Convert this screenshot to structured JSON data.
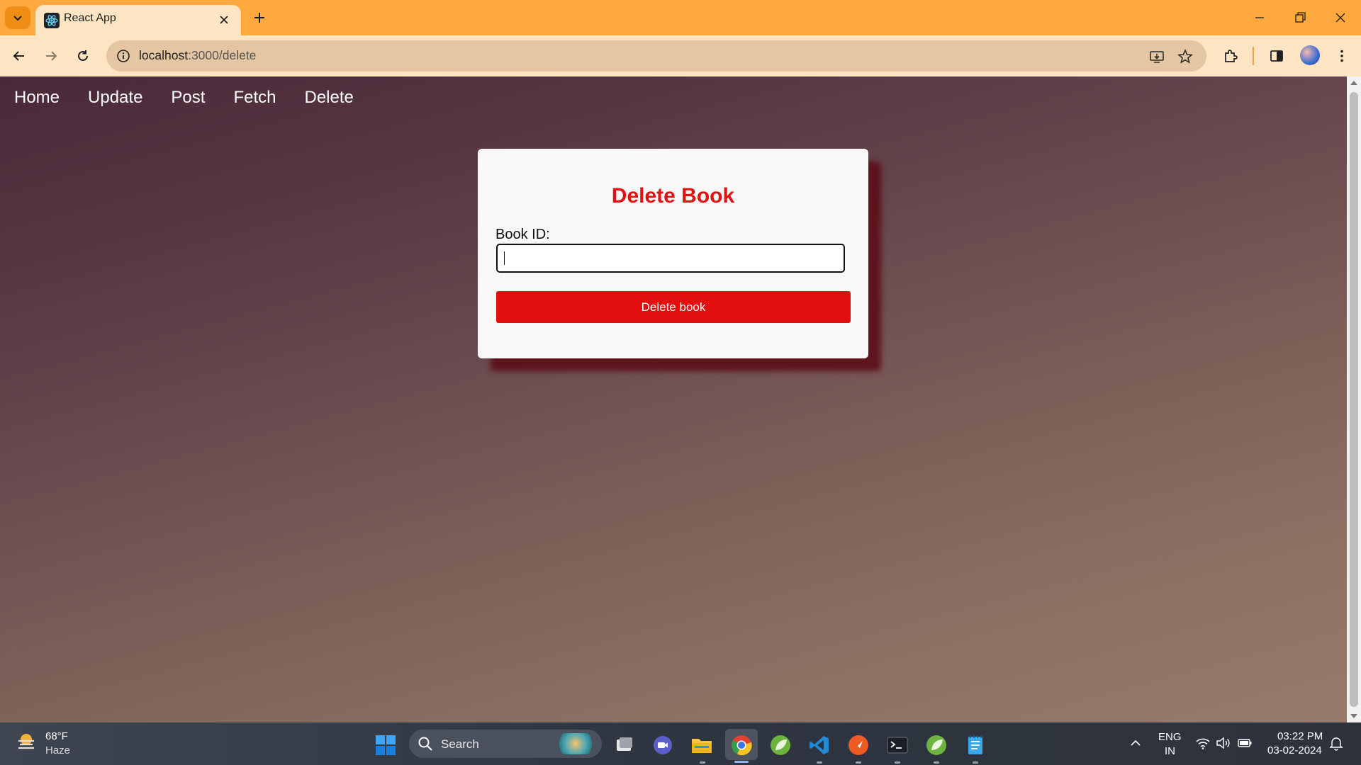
{
  "browser": {
    "tab_title": "React App",
    "url_host": "localhost",
    "url_path": ":3000/delete"
  },
  "nav": {
    "items": [
      "Home",
      "Update",
      "Post",
      "Fetch",
      "Delete"
    ]
  },
  "form": {
    "heading": "Delete Book",
    "field_label": "Book ID:",
    "field_value": "",
    "button_label": "Delete book"
  },
  "taskbar": {
    "weather_temp": "68°F",
    "weather_condition": "Haze",
    "search_placeholder": "Search",
    "lang_line1": "ENG",
    "lang_line2": "IN",
    "time": "03:22 PM",
    "date": "03-02-2024"
  },
  "colors": {
    "heading": "#e31212",
    "button": "#e30e0e",
    "tabbar": "#ffa93f",
    "toolbar": "#fde4c3"
  }
}
